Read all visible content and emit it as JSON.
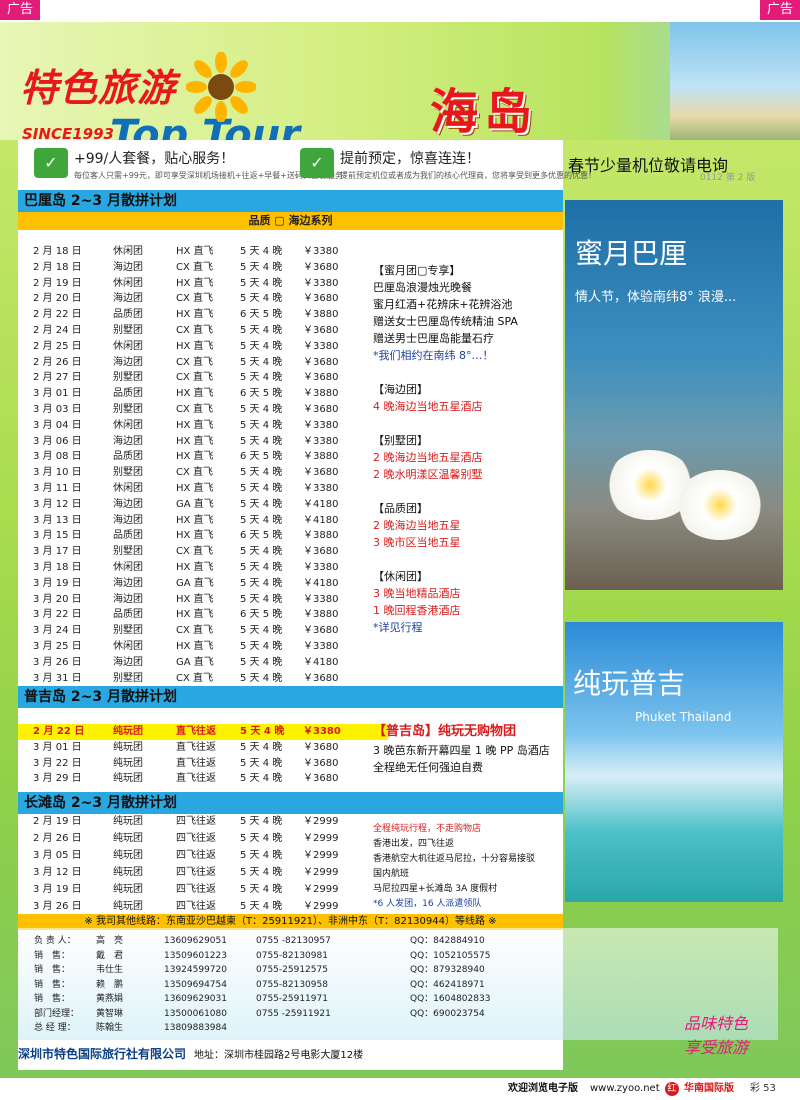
{
  "ads": {
    "left": "广告",
    "right": "广告"
  },
  "header": {
    "logo_cn": "特色旅游",
    "logo_since": "SINCE1993",
    "logo_en": "Top Tour",
    "title": "海岛"
  },
  "promo1": {
    "title": "+99/人套餐，贴心服务！",
    "sub": "每位客人只需+99元，即可享受深圳机场接机+往返+早餐+送码头套餐服务！"
  },
  "promo2": {
    "title": "提前预定，惊喜连连！",
    "sub": "提前预定机位或者成为我们的核心代理商，您将享受到更多优惠的优惠！"
  },
  "spring": "春节少量机位敬请电询",
  "code": "0112 第 2 版",
  "bali": {
    "title": "巴厘岛 2~3 月散拼计划",
    "series": "品质 ▢ 海边系列",
    "rows": [
      [
        "2 月 18 日",
        "休闲团",
        "HX 直飞",
        "5 天 4 晚",
        "￥3380"
      ],
      [
        "2 月 18 日",
        "海边团",
        "CX 直飞",
        "5 天 4 晚",
        "￥3680"
      ],
      [
        "2 月 19 日",
        "休闲团",
        "HX 直飞",
        "5 天 4 晚",
        "￥3380"
      ],
      [
        "2 月 20 日",
        "海边团",
        "CX 直飞",
        "5 天 4 晚",
        "￥3680"
      ],
      [
        "2 月 22 日",
        "品质团",
        "HX 直飞",
        "6 天 5 晚",
        "￥3880"
      ],
      [
        "2 月 24 日",
        "别墅团",
        "CX 直飞",
        "5 天 4 晚",
        "￥3680"
      ],
      [
        "2 月 25 日",
        "休闲团",
        "HX 直飞",
        "5 天 4 晚",
        "￥3380"
      ],
      [
        "2 月 26 日",
        "海边团",
        "CX 直飞",
        "5 天 4 晚",
        "￥3680"
      ],
      [
        "2 月 27 日",
        "别墅团",
        "CX 直飞",
        "5 天 4 晚",
        "￥3680"
      ],
      [
        "3 月 01 日",
        "品质团",
        "HX 直飞",
        "6 天 5 晚",
        "￥3880"
      ],
      [
        "3 月 03 日",
        "别墅团",
        "CX 直飞",
        "5 天 4 晚",
        "￥3680"
      ],
      [
        "3 月 04 日",
        "休闲团",
        "HX 直飞",
        "5 天 4 晚",
        "￥3380"
      ],
      [
        "3 月 06 日",
        "海边团",
        "HX 直飞",
        "5 天 4 晚",
        "￥3380"
      ],
      [
        "3 月 08 日",
        "品质团",
        "HX 直飞",
        "6 天 5 晚",
        "￥3880"
      ],
      [
        "3 月 10 日",
        "别墅团",
        "CX 直飞",
        "5 天 4 晚",
        "￥3680"
      ],
      [
        "3 月 11 日",
        "休闲团",
        "HX 直飞",
        "5 天 4 晚",
        "￥3380"
      ],
      [
        "3 月 12 日",
        "海边团",
        "GA 直飞",
        "5 天 4 晚",
        "￥4180"
      ],
      [
        "3 月 13 日",
        "海边团",
        "HX 直飞",
        "5 天 4 晚",
        "￥4180"
      ],
      [
        "3 月 15 日",
        "品质团",
        "HX 直飞",
        "6 天 5 晚",
        "￥3880"
      ],
      [
        "3 月 17 日",
        "别墅团",
        "CX 直飞",
        "5 天 4 晚",
        "￥3680"
      ],
      [
        "3 月 18 日",
        "休闲团",
        "HX 直飞",
        "5 天 4 晚",
        "￥3380"
      ],
      [
        "3 月 19 日",
        "海边团",
        "GA 直飞",
        "5 天 4 晚",
        "￥4180"
      ],
      [
        "3 月 20 日",
        "海边团",
        "HX 直飞",
        "5 天 4 晚",
        "￥3380"
      ],
      [
        "3 月 22 日",
        "品质团",
        "HX 直飞",
        "6 天 5 晚",
        "￥3880"
      ],
      [
        "3 月 24 日",
        "别墅团",
        "CX 直飞",
        "5 天 4 晚",
        "￥3680"
      ],
      [
        "3 月 25 日",
        "休闲团",
        "HX 直飞",
        "5 天 4 晚",
        "￥3380"
      ],
      [
        "3 月 26 日",
        "海边团",
        "GA 直飞",
        "5 天 4 晚",
        "￥4180"
      ],
      [
        "3 月 31 日",
        "别墅团",
        "CX 直飞",
        "5 天 4 晚",
        "￥3680"
      ]
    ],
    "notes": [
      {
        "t": "【蜜月团▢专享】",
        "c": "h"
      },
      {
        "t": "巴厘岛浪漫烛光晚餐",
        "c": "h"
      },
      {
        "t": "蜜月红酒+花辨床+花辨浴池",
        "c": "h"
      },
      {
        "t": "赠送女士巴厘岛传统精油 SPA",
        "c": "h"
      },
      {
        "t": "赠送男士巴厘岛能量石疗",
        "c": "h"
      },
      {
        "t": "*我们相约在南纬 8°…！",
        "c": "b"
      },
      {
        "t": "",
        "c": "h"
      },
      {
        "t": "【海边团】",
        "c": "h"
      },
      {
        "t": "4 晚海边当地五星酒店",
        "c": "r"
      },
      {
        "t": "",
        "c": "h"
      },
      {
        "t": "【别墅团】",
        "c": "h"
      },
      {
        "t": "2 晚海边当地五星酒店",
        "c": "r"
      },
      {
        "t": "2 晚水明漾区温馨别墅",
        "c": "r"
      },
      {
        "t": "",
        "c": "h"
      },
      {
        "t": "【品质团】",
        "c": "h"
      },
      {
        "t": "2 晚海边当地五星",
        "c": "r"
      },
      {
        "t": "3 晚市区当地五星",
        "c": "r"
      },
      {
        "t": "",
        "c": "h"
      },
      {
        "t": "【休闲团】",
        "c": "h"
      },
      {
        "t": "3 晚当地精品酒店",
        "c": "r"
      },
      {
        "t": "1 晚回程香港酒店",
        "c": "r"
      },
      {
        "t": "*详见行程",
        "c": "b"
      }
    ]
  },
  "phuket": {
    "title": "普吉岛 2~3 月散拼计划",
    "rows": [
      [
        "2 月 22 日",
        "纯玩团",
        "直飞往返",
        "5 天 4 晚",
        "￥3380"
      ],
      [
        "3 月 01 日",
        "纯玩团",
        "直飞往返",
        "5 天 4 晚",
        "￥3680"
      ],
      [
        "3 月 22 日",
        "纯玩团",
        "直飞往返",
        "5 天 4 晚",
        "￥3680"
      ],
      [
        "3 月 29 日",
        "纯玩团",
        "直飞往返",
        "5 天 4 晚",
        "￥3680"
      ]
    ],
    "note_title": "【普吉岛】纯玩无购物团",
    "note1": "3 晚芭东新开幕四星 1 晚 PP 岛酒店",
    "note2": "全程绝无任何强迫自费"
  },
  "boracay": {
    "title": "长滩岛 2~3 月散拼计划",
    "rows": [
      [
        "2 月 19 日",
        "纯玩团",
        "四飞往返",
        "5 天 4 晚",
        "￥2999"
      ],
      [
        "2 月 26 日",
        "纯玩团",
        "四飞往返",
        "5 天 4 晚",
        "￥2999"
      ],
      [
        "3 月 05 日",
        "纯玩团",
        "四飞往返",
        "5 天 4 晚",
        "￥2999"
      ],
      [
        "3 月 12 日",
        "纯玩团",
        "四飞往返",
        "5 天 4 晚",
        "￥2999"
      ],
      [
        "3 月 19 日",
        "纯玩团",
        "四飞往返",
        "5 天 4 晚",
        "￥2999"
      ],
      [
        "3 月 26 日",
        "纯玩团",
        "四飞往返",
        "5 天 4 晚",
        "￥2999"
      ]
    ],
    "notes": [
      {
        "t": "全程纯玩行程，不走购物店",
        "c": "r"
      },
      {
        "t": "香港出发，四飞往返",
        "c": "h"
      },
      {
        "t": "香港航空大机往返马尼拉，十分容易接驳",
        "c": "h"
      },
      {
        "t": "国内航班",
        "c": "h"
      },
      {
        "t": "马尼拉四星+长滩岛 3A 度假村",
        "c": "h"
      },
      {
        "t": "*6 人发团，16 人派遣领队",
        "c": "b"
      }
    ]
  },
  "other_routes": "※ 我司其他线路：东南亚沙巴越柬（T：25911921）、非洲中东（T：82130944）等线路 ※",
  "contacts": [
    [
      "负 责 人：",
      "高　亮",
      "13609629051",
      "0755 -82130957",
      "QQ：842884910"
    ],
    [
      "销　售：",
      "戴　君",
      "13509601223",
      "0755-82130981",
      "QQ：1052105575"
    ],
    [
      "销　售：",
      "韦仕生",
      "13924599720",
      "0755-25912575",
      "QQ：879328940"
    ],
    [
      "销　售：",
      "赖　鹏",
      "13509694754",
      "0755-82130958",
      "QQ：462418971"
    ],
    [
      "销　售：",
      "黄燕娟",
      "13609629031",
      "0755-25911971",
      "QQ：1604802833"
    ],
    [
      "部门经理：",
      "黄智琳",
      "13500061080",
      "0755 -25911921",
      "QQ：690023754"
    ],
    [
      "总 经 理：",
      "陈翰生",
      "13809883984",
      "",
      ""
    ]
  ],
  "footer": {
    "company": "深圳市特色国际旅行社有限公司",
    "address": "地址：深圳市桂园路2号电影大厦12楼"
  },
  "slogan": {
    "l1": "品味特色",
    "l2": "享受旅游"
  },
  "side": {
    "bali_title": "蜜月巴厘",
    "bali_sub": "情人节，体验南纬8°  浪漫...",
    "phuket_title": "纯玩普吉",
    "phuket_sub": "Phuket Thailand"
  },
  "bottom": {
    "welcome": "欢迎浏览电子版",
    "site": "www.zyoo.net",
    "edition": "华南国际版",
    "page": "彩 53"
  }
}
